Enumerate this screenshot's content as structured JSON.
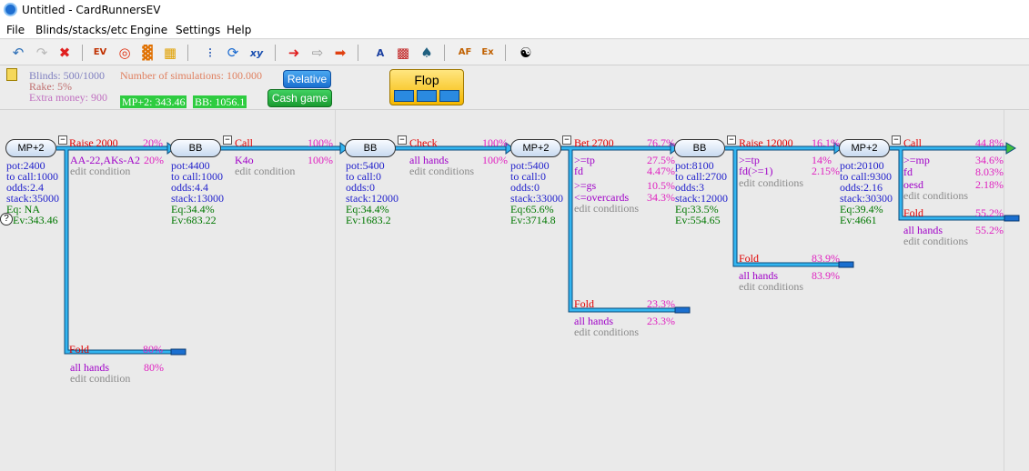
{
  "window": {
    "title": "Untitled - CardRunnersEV"
  },
  "menu": [
    "File",
    "Blinds/stacks/etc",
    "Engine",
    "Settings",
    "Help"
  ],
  "toolbar_icons": [
    "undo-arrow",
    "redo-arrow",
    "delete-x",
    "ev-flag",
    "lifebuoy",
    "bar-chart",
    "gift-chart",
    "scatter-chart",
    "refresh-circle",
    "xy-graph",
    "red-arrow-flag",
    "white-arrow",
    "red-arrow",
    "zoom-text",
    "color-grid",
    "card-icon",
    "af-icon",
    "ex-icon",
    "yin-yang"
  ],
  "info": {
    "blinds": "Blinds: 500/1000",
    "rake": "Rake: 5%",
    "extra_money": "Extra money: 900",
    "simulations": "Number of simulations: 100.000",
    "ev_mp": "MP+2: 343.46",
    "ev_bb": "BB: 1056.1",
    "relative_btn": "Relative",
    "cashgame_btn": "Cash game",
    "street": "Flop"
  },
  "colors": {
    "action": "#e00000",
    "stats": "#2222cc",
    "equity": "#007700",
    "pct": "#e020c0",
    "hands": "#a000c8",
    "conditions": "#8a8a8a",
    "line": "#33b5f0"
  },
  "tree": {
    "n1": {
      "player": "MP+2",
      "lines": [
        "pot:2400",
        "to call:1000",
        "odds:2.4",
        "stack:35000",
        "Eq: NA",
        "Ev:343.46"
      ],
      "unknown": "?"
    },
    "a1": {
      "action": "Raise 2000",
      "pct": "20%",
      "hand": "AA-22,AKs-A2",
      "hand_pct": "20%",
      "cond": "edit condition"
    },
    "a1f": {
      "action": "Fold",
      "pct": "80%",
      "hand": "all hands",
      "hand_pct": "80%",
      "cond": "edit condition"
    },
    "n2": {
      "player": "BB",
      "lines": [
        "pot:4400",
        "to call:1000",
        "odds:4.4",
        "stack:13000",
        "Eq:34.4%",
        "Ev:683.22"
      ]
    },
    "a2": {
      "action": "Call",
      "pct": "100%",
      "hand": "K4o",
      "hand_pct": "100%",
      "cond": "edit condition"
    },
    "n3": {
      "player": "BB",
      "lines": [
        "pot:5400",
        "to call:0",
        "odds:0",
        "stack:12000",
        "Eq:34.4%",
        "Ev:1683.2"
      ]
    },
    "a3": {
      "action": "Check",
      "pct": "100%",
      "hand": "all hands",
      "hand_pct": "100%",
      "cond": "edit conditions"
    },
    "n4": {
      "player": "MP+2",
      "lines": [
        "pot:5400",
        "to call:0",
        "odds:0",
        "stack:33000",
        "Eq:65.6%",
        "Ev:3714.8"
      ]
    },
    "a4": {
      "action": "Bet 2700",
      "pct": "76.7%",
      "rows": [
        {
          "h": ">=tp",
          "p": "27.5%"
        },
        {
          "h": "fd",
          "p": "4.47%"
        },
        {
          "h": ">=gs",
          "p": "10.5%"
        },
        {
          "h": "<=overcards",
          "p": "34.3%"
        }
      ],
      "cond": "edit conditions"
    },
    "a4f": {
      "action": "Fold",
      "pct": "23.3%",
      "hand": "all hands",
      "hand_pct": "23.3%",
      "cond": "edit conditions"
    },
    "n5": {
      "player": "BB",
      "lines": [
        "pot:8100",
        "to call:2700",
        "odds:3",
        "stack:12000",
        "Eq:33.5%",
        "Ev:554.65"
      ]
    },
    "a5": {
      "action": "Raise 12000",
      "pct": "16.1%",
      "rows": [
        {
          "h": ">=tp",
          "p": "14%"
        },
        {
          "h": "fd(>=1)",
          "p": "2.15%"
        }
      ],
      "cond": "edit conditions"
    },
    "a5f": {
      "action": "Fold",
      "pct": "83.9%",
      "hand": "all hands",
      "hand_pct": "83.9%",
      "cond": "edit conditions"
    },
    "n6": {
      "player": "MP+2",
      "lines": [
        "pot:20100",
        "to call:9300",
        "odds:2.16",
        "stack:30300",
        "Eq:39.4%",
        "Ev:4661"
      ]
    },
    "a6": {
      "action": "Call",
      "pct": "44.8%",
      "rows": [
        {
          "h": ">=mp",
          "p": "34.6%"
        },
        {
          "h": "fd",
          "p": "8.03%"
        },
        {
          "h": "oesd",
          "p": "2.18%"
        }
      ],
      "cond": "edit conditions"
    },
    "a6f": {
      "action": "Fold",
      "pct": "55.2%",
      "hand": "all hands",
      "hand_pct": "55.2%",
      "cond": "edit conditions"
    }
  }
}
